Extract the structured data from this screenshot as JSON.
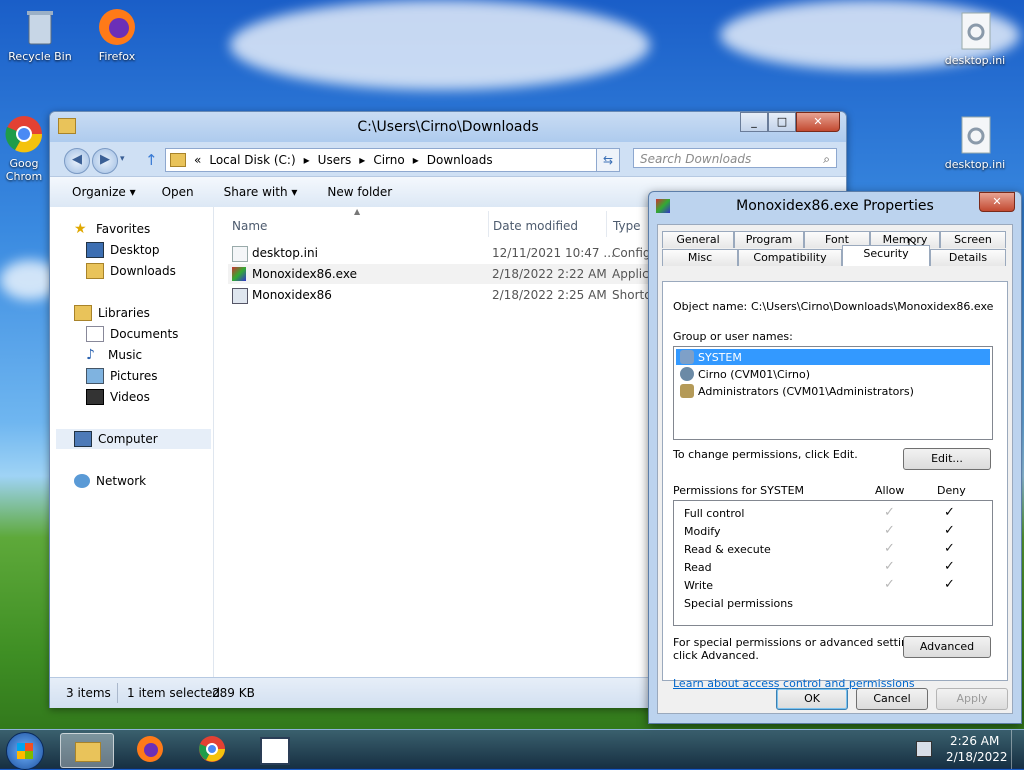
{
  "desktop": {
    "icons": [
      {
        "label": "Recycle Bin"
      },
      {
        "label": "Firefox"
      },
      {
        "label": "Goog Chrom"
      },
      {
        "label": "desktop.ini"
      },
      {
        "label": "desktop.ini"
      }
    ]
  },
  "explorer": {
    "title": "C:\\Users\\Cirno\\Downloads",
    "address": {
      "prefix": "«",
      "parts": [
        "Local Disk (C:)",
        "Users",
        "Cirno",
        "Downloads"
      ]
    },
    "search_placeholder": "Search Downloads",
    "toolbar": {
      "organize": "Organize ▾",
      "open": "Open",
      "share_with": "Share with ▾",
      "new_folder": "New folder"
    },
    "nav": {
      "favorites": "Favorites",
      "desktop": "Desktop",
      "downloads": "Downloads",
      "libraries": "Libraries",
      "documents": "Documents",
      "music": "Music",
      "pictures": "Pictures",
      "videos": "Videos",
      "computer": "Computer",
      "network": "Network"
    },
    "columns": {
      "name": "Name",
      "date": "Date modified",
      "type": "Type"
    },
    "files": [
      {
        "name": "desktop.ini",
        "date": "12/11/2021 10:47 ...",
        "type": "Config"
      },
      {
        "name": "Monoxidex86.exe",
        "date": "2/18/2022 2:22 AM",
        "type": "Applic"
      },
      {
        "name": "Monoxidex86",
        "date": "2/18/2022 2:25 AM",
        "type": "Shorto"
      }
    ],
    "status": {
      "count": "3 items",
      "selected": "1 item selected",
      "size": "289 KB"
    }
  },
  "properties": {
    "title": "Monoxidex86.exe Properties",
    "tabs_top": [
      "General",
      "Program",
      "Font",
      "Memory",
      "Screen"
    ],
    "tabs_bottom": [
      "Misc",
      "Compatibility",
      "Security",
      "Details"
    ],
    "object_label": "Object name:",
    "object_value": "C:\\Users\\Cirno\\Downloads\\Monoxidex86.exe",
    "group_label": "Group or user names:",
    "users": [
      "SYSTEM",
      "Cirno (CVM01\\Cirno)",
      "Administrators (CVM01\\Administrators)"
    ],
    "change_text": "To change permissions, click Edit.",
    "edit_button": "Edit...",
    "perm_header": "Permissions for SYSTEM",
    "allow_header": "Allow",
    "deny_header": "Deny",
    "permissions": [
      {
        "name": "Full control",
        "allow": "✓",
        "deny": "✓"
      },
      {
        "name": "Modify",
        "allow": "✓",
        "deny": "✓"
      },
      {
        "name": "Read & execute",
        "allow": "✓",
        "deny": "✓"
      },
      {
        "name": "Read",
        "allow": "✓",
        "deny": "✓"
      },
      {
        "name": "Write",
        "allow": "✓",
        "deny": "✓"
      },
      {
        "name": "Special permissions",
        "allow": "",
        "deny": ""
      }
    ],
    "special_text_1": "For special permissions or advanced settings,",
    "special_text_2": "click Advanced.",
    "advanced_button": "Advanced",
    "learn_link": "Learn about access control and permissions",
    "ok": "OK",
    "cancel": "Cancel",
    "apply": "Apply"
  },
  "taskbar": {
    "time": "2:26 AM",
    "date": "2/18/2022"
  }
}
